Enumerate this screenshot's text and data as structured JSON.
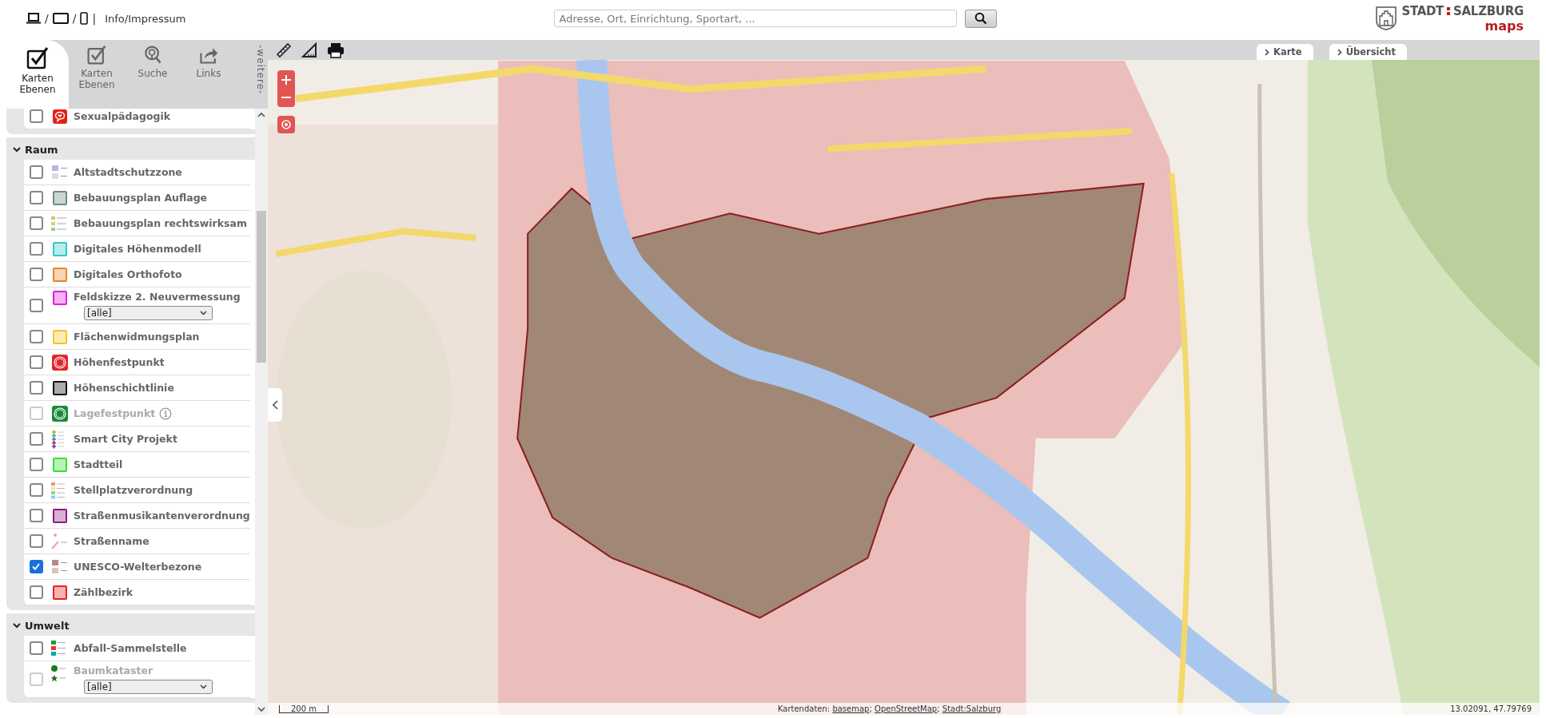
{
  "header": {
    "device_separators": [
      "/",
      "/",
      "|"
    ],
    "info_link": "Info/Impressum",
    "search": {
      "placeholder": "Adresse, Ort, Einrichtung, Sportart, ..."
    },
    "logo": {
      "word1": "STADT",
      "word2": "SALZBURG",
      "word3": "maps"
    }
  },
  "sidebar": {
    "tabs": [
      {
        "label": "Karten Ebenen",
        "kind": "check",
        "selected": true
      },
      {
        "label": "Karten Ebenen",
        "kind": "check",
        "selected": false
      },
      {
        "label": "Suche",
        "kind": "search",
        "selected": false
      },
      {
        "label": "Links",
        "kind": "share",
        "selected": false
      }
    ],
    "more": "-weitere-",
    "groups": [
      {
        "items": [
          {
            "label": "Sexualpädagogik",
            "kind": "speech-heart",
            "color": "#e32119",
            "checked": false,
            "disabled": false
          }
        ]
      },
      {
        "title": "Raum",
        "expanded": true,
        "items": [
          {
            "label": "Altstadtschutzzone",
            "kind": "pair",
            "color": "#b9b3e0",
            "checked": false,
            "disabled": false
          },
          {
            "label": "Bebauungsplan Auflage",
            "kind": "swatch",
            "color": "#6e8a86",
            "checked": false,
            "disabled": false
          },
          {
            "label": "Bebauungsplan rechtswirksam",
            "kind": "stack-plan",
            "checked": false,
            "disabled": false
          },
          {
            "label": "Digitales Höhenmodell",
            "kind": "swatch",
            "color": "#2ec9c9",
            "checked": false,
            "disabled": false
          },
          {
            "label": "Digitales Orthofoto",
            "kind": "swatch",
            "color": "#e8852a",
            "checked": false,
            "disabled": false
          },
          {
            "label": "Feldskizze 2. Neuvermessung",
            "kind": "swatch",
            "color": "#e01fe0",
            "checked": false,
            "disabled": false,
            "select": "[alle]"
          },
          {
            "label": "Flächenwidmungsplan",
            "kind": "swatch",
            "color": "#f5c52a",
            "checked": false,
            "disabled": false
          },
          {
            "label": "Höhenfestpunkt",
            "kind": "ring",
            "color": "#e2262b",
            "checked": false,
            "disabled": false
          },
          {
            "label": "Höhenschichtlinie",
            "kind": "swatch",
            "color": "#111111",
            "checked": false,
            "disabled": false
          },
          {
            "label": "Lagefestpunkt",
            "kind": "ring",
            "color": "#1a8a3a",
            "checked": false,
            "disabled": true,
            "info": true
          },
          {
            "label": "Smart City Projekt",
            "kind": "crosses",
            "checked": false,
            "disabled": false
          },
          {
            "label": "Stadtteil",
            "kind": "swatch",
            "color": "#33e033",
            "checked": false,
            "disabled": false
          },
          {
            "label": "Stellplatzverordnung",
            "kind": "stack-parking",
            "checked": false,
            "disabled": false
          },
          {
            "label": "Straßenmusikantenverordnung",
            "kind": "swatch",
            "color": "#8a1a8a",
            "checked": false,
            "disabled": false
          },
          {
            "label": "Straßenname",
            "kind": "street",
            "checked": false,
            "disabled": false
          },
          {
            "label": "UNESCO-Welterbezone",
            "kind": "pair",
            "color": "#b78a8a",
            "checked": true,
            "disabled": false
          },
          {
            "label": "Zählbezirk",
            "kind": "swatch",
            "color": "#e22222",
            "checked": false,
            "disabled": false
          }
        ]
      },
      {
        "title": "Umwelt",
        "expanded": true,
        "items": [
          {
            "label": "Abfall-Sammelstelle",
            "kind": "stack-waste",
            "checked": false,
            "disabled": false
          },
          {
            "label": "Baumkataster",
            "kind": "tree",
            "checked": false,
            "disabled": true,
            "select": "[alle]"
          }
        ]
      }
    ]
  },
  "map": {
    "tabs": [
      {
        "label": "Karte"
      },
      {
        "label": "Übersicht"
      }
    ],
    "scale": "200 m",
    "attribution": {
      "prefix": "Kartendaten:",
      "separator": ";",
      "links": [
        "basemap",
        "OpenStreetMap",
        "Stadt:Salzburg"
      ]
    },
    "coordinates": "13.02091, 47.79769"
  }
}
